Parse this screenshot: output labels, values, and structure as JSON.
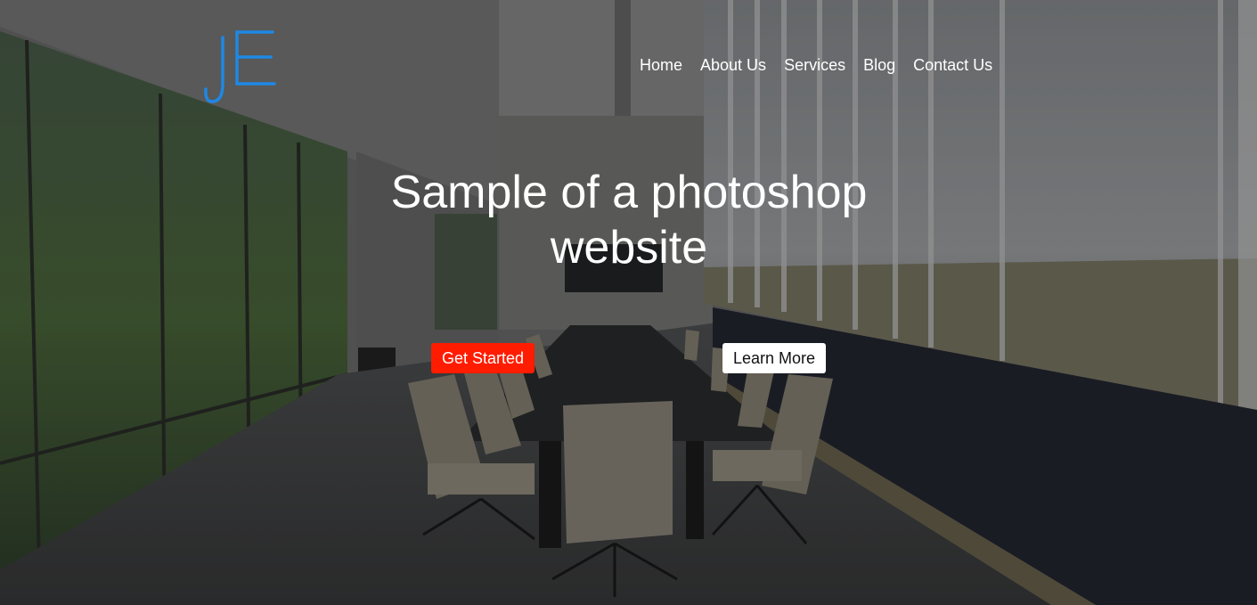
{
  "header": {
    "logo_text": "JE",
    "nav": [
      {
        "label": "Home"
      },
      {
        "label": "About Us"
      },
      {
        "label": "Services"
      },
      {
        "label": "Blog"
      },
      {
        "label": "Contact Us"
      }
    ]
  },
  "hero": {
    "title": "Sample of a photoshop website",
    "primary_button": "Get Started",
    "secondary_button": "Learn More"
  },
  "colors": {
    "logo": "#1e88e5",
    "primary_button": "#ff1c00",
    "secondary_button": "#ffffff",
    "text": "#ffffff"
  }
}
